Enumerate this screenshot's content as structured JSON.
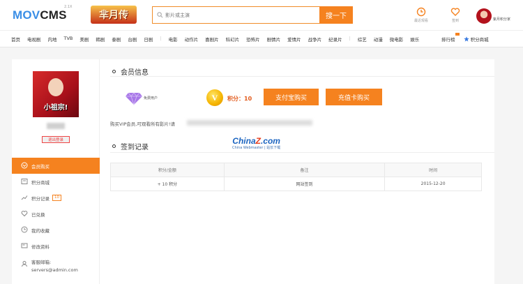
{
  "header": {
    "logo_mov": "MOV",
    "logo_cms": "CMS",
    "logo_version": "2.1X",
    "banner_text": "芈月传",
    "search_placeholder": "影片或主演",
    "search_button": "搜一下",
    "history_label": "最近观看",
    "signin_label": "签到",
    "user_label": "紫月积分家"
  },
  "nav": {
    "left": [
      "首页",
      "电视剧",
      "内地",
      "TVB",
      "美剧",
      "韩剧",
      "泰剧",
      "台剧",
      "日剧"
    ],
    "movies": [
      "电影",
      "动作片",
      "喜剧片",
      "科幻片",
      "恐怖片",
      "剧情片",
      "爱情片",
      "战争片",
      "纪录片",
      "综艺",
      "动漫",
      "微电影",
      "娱乐"
    ],
    "right": [
      "排行榜",
      "积分商城"
    ]
  },
  "sidebar": {
    "avatar_caption": "小祖宗!",
    "logout": "退出登录",
    "items": [
      {
        "label": "会员购买",
        "icon": "vip-icon"
      },
      {
        "label": "积分商城",
        "icon": "shop-icon"
      },
      {
        "label": "积分记录",
        "icon": "chart-icon",
        "badge": "10"
      },
      {
        "label": "已兑换",
        "icon": "heart-icon"
      },
      {
        "label": "我的收藏",
        "icon": "clock-icon"
      },
      {
        "label": "修改资料",
        "icon": "card-icon"
      }
    ],
    "contact_label": "客服邮箱:",
    "contact_email": "servers@admin.com"
  },
  "member": {
    "title": "会员信息",
    "vip_label": "免费用户",
    "points": "积分：10",
    "alipay_button": "支付宝购买",
    "card_button": "充值卡购买",
    "note": "购买VIP会员,可观看所有影片!请"
  },
  "watermark": {
    "main_a": "China",
    "main_z": "Z",
    "main_b": ".com",
    "sub": "China Webmaster | 站长下载"
  },
  "signin": {
    "title": "签到记录",
    "columns": [
      "积分/金额",
      "备注",
      "时间"
    ],
    "rows": [
      [
        "+ 10 积分",
        "网站签到",
        "2015-12-20"
      ]
    ]
  }
}
